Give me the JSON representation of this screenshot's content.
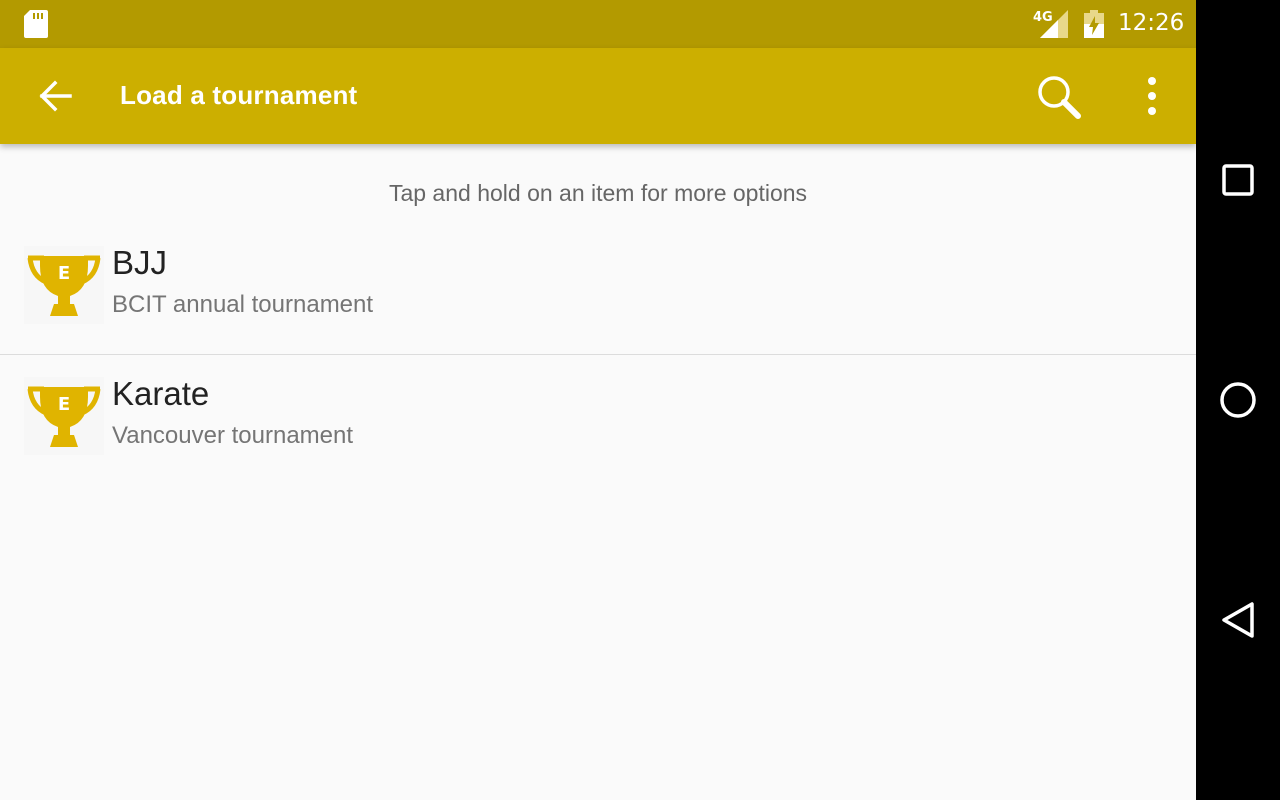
{
  "status_bar": {
    "network": "4G",
    "time": "12:26",
    "icons": [
      "sd-card-icon",
      "signal-icon",
      "battery-icon"
    ]
  },
  "app_bar": {
    "title": "Load a tournament",
    "icons": [
      "back-arrow-icon",
      "search-icon",
      "overflow-menu-icon"
    ],
    "color": "#ccaf00",
    "status_color": "#b39a00"
  },
  "hint": "Tap and hold on an item for more options",
  "tournaments": [
    {
      "name": "BJJ",
      "description": "BCIT annual tournament",
      "icon": "trophy-icon"
    },
    {
      "name": "Karate",
      "description": "Vancouver tournament",
      "icon": "trophy-icon"
    }
  ],
  "navigation": [
    "recents-icon",
    "home-icon",
    "back-icon"
  ],
  "colors": {
    "trophy": "#e0b400",
    "background": "#fafafa"
  }
}
